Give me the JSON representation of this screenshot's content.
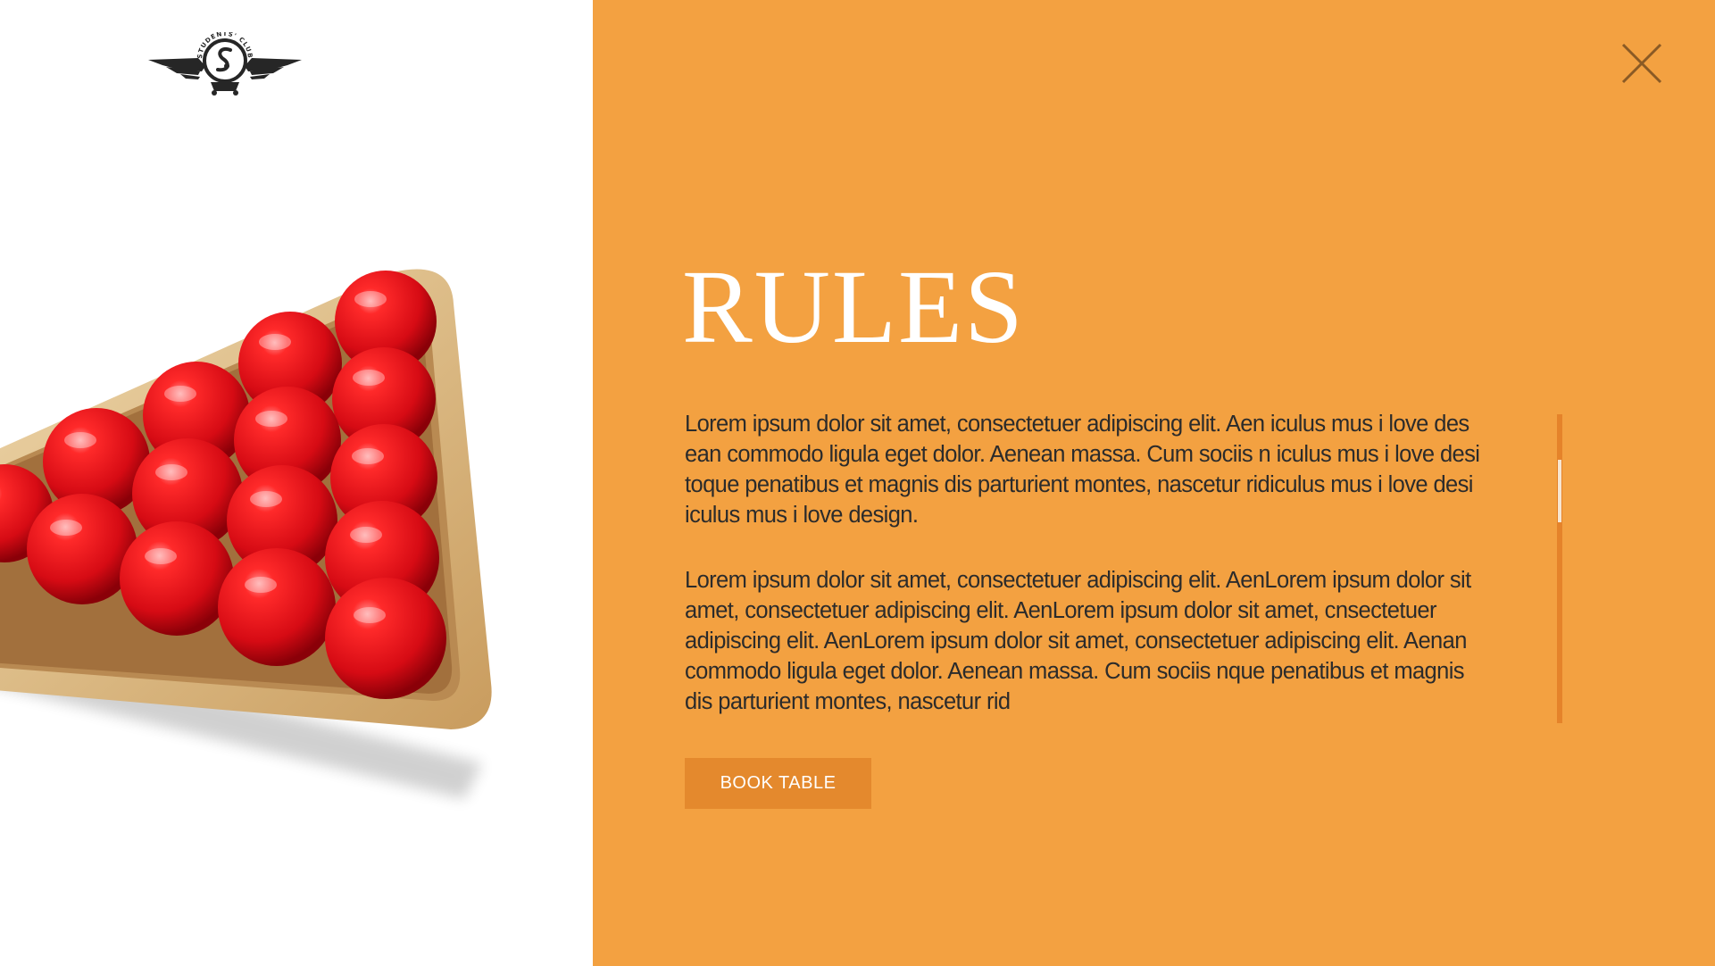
{
  "logo": {
    "text": "STUDENTS' CLUB",
    "icon": "winged-emblem-logo"
  },
  "close": {
    "icon": "close-icon"
  },
  "section": {
    "title": "RULES"
  },
  "body": {
    "paragraphs": [
      "Lorem ipsum dolor sit amet, consectetuer adipiscing elit. Aen iculus mus i love des ean commodo ligula eget dolor. Aenean massa. Cum sociis n iculus mus i love desi toque penatibus et magnis dis parturient montes, nascetur ridiculus mus i love desi iculus mus i love design.",
      "Lorem ipsum dolor sit amet, consectetuer adipiscing elit. AenLorem ipsum dolor sit amet, consectetuer adipiscing elit. AenLorem ipsum dolor sit amet, cnsectetuer adipiscing elit. AenLorem ipsum dolor sit amet, consectetuer adipiscing elit. Aenan commodo ligula eget dolor. Aenean massa. Cum sociis nque penatibus et magnis dis parturient montes, nascetur rid"
    ]
  },
  "cta": {
    "label": "BOOK TABLE"
  },
  "colors": {
    "panel": "#f3a141",
    "button": "#e4892d",
    "scrollbar": "#e5832a",
    "ball": "#e8101a",
    "wood": "#e2c596"
  }
}
